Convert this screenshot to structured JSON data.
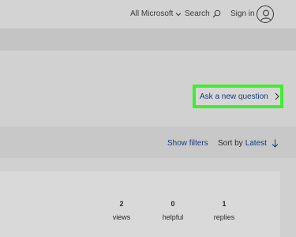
{
  "header": {
    "all_microsoft": "All Microsoft",
    "search": "Search",
    "sign_in": "Sign in"
  },
  "ask_button": {
    "label": "Ask a new question"
  },
  "toolbar": {
    "show_filters": "Show filters",
    "sort_by_label": "Sort by",
    "sort_value": "Latest"
  },
  "stats": {
    "views": {
      "count": "2",
      "label": "views"
    },
    "helpful": {
      "count": "0",
      "label": "helpful"
    },
    "replies": {
      "count": "1",
      "label": "replies"
    }
  },
  "colors": {
    "highlight": "#3ef02c",
    "link": "#1a3a7a",
    "background": "#d0d0d0"
  }
}
